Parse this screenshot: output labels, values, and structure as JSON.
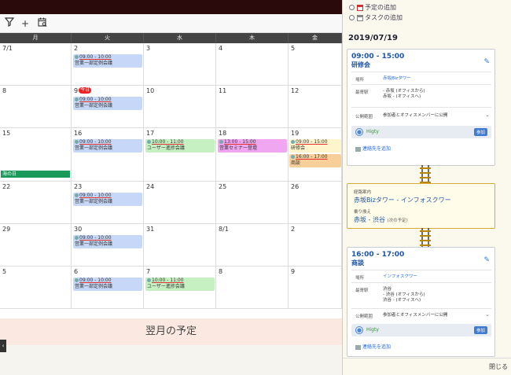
{
  "toolbar": {
    "filter_icon": "filter-icon",
    "add_icon": "plus-icon",
    "calendar_search_icon": "calendar-search-icon",
    "add_glyph": "+"
  },
  "weekdays": [
    "月",
    "火",
    "水",
    "木",
    "金"
  ],
  "weeks": [
    [
      "7/1",
      "2",
      "3",
      "4",
      "5"
    ],
    [
      "8",
      "9",
      "10",
      "11",
      "12"
    ],
    [
      "15",
      "16",
      "17",
      "18",
      "19"
    ],
    [
      "22",
      "23",
      "24",
      "25",
      "26"
    ],
    [
      "29",
      "30",
      "31",
      "8/1",
      "2"
    ],
    [
      "5",
      "6",
      "7",
      "8",
      "9"
    ]
  ],
  "today_badge": "今日",
  "holiday": "海の日",
  "events": {
    "w1_tue": {
      "time": "09:00 - 10:00",
      "title": "営業一部定例会議"
    },
    "w2_tue": {
      "time": "09:00 - 10:00",
      "title": "営業一部定例会議"
    },
    "w3_tue": {
      "time": "09:00 - 10:00",
      "title": "営業一部定例会議"
    },
    "w3_wed": {
      "time": "10:00 - 11:00",
      "title": "ユーザー進捗会議"
    },
    "w3_thu": {
      "time": "13:00 - 15:00",
      "title": "営業セミナー登壇"
    },
    "w3_fri_a": {
      "time": "09:00 - 15:00",
      "title": "研修会"
    },
    "w3_fri_b": {
      "time": "16:00 - 17:00",
      "title": "商談"
    },
    "w4_tue": {
      "time": "09:00 - 10:00",
      "title": "営業一部定例会議"
    },
    "w5_tue": {
      "time": "09:00 - 10:00",
      "title": "営業一部定例会議"
    },
    "w6_tue": {
      "time": "09:00 - 10:00",
      "title": "営業一部定例会議"
    },
    "w6_wed": {
      "time": "10:00 - 11:00",
      "title": "ユーザー進捗会議"
    }
  },
  "next_month_label": "翌月の予定",
  "side_panel": {
    "add_schedule": "予定の追加",
    "add_task": "タスクの追加",
    "date": "2019/07/19",
    "card1": {
      "time": "09:00 - 15:00",
      "title": "研修会",
      "place_label": "場所",
      "place": "赤坂Bizタワー",
      "station_label": "最寄駅",
      "stations": [
        "- 赤坂 (オフィスから)",
        "赤坂 - (オフィスへ)"
      ],
      "station_link_prefix": "赤坂",
      "visibility_label": "公開範囲",
      "visibility": "参加者とオフィスメンバーに公開",
      "member": "Higty",
      "join": "参加",
      "add_contact": "連絡先を追加"
    },
    "route": {
      "route_label": "経路案内",
      "route_value": "赤坂Bizタワー - インフォスクワー",
      "transfer_label": "乗り換え",
      "transfer_value": "赤坂 - 渋谷",
      "transfer_note": "(次の予定)"
    },
    "card2": {
      "time": "16:00 - 17:00",
      "title": "商談",
      "place_label": "場所",
      "place": "インフォスクワー",
      "station_label": "最寄駅",
      "station_main": "渋谷",
      "stations": [
        "- 渋谷 (オフィスから)",
        "渋谷 - (オフィスへ)"
      ],
      "visibility_label": "公開範囲",
      "visibility": "参加者とオフィスメンバーに公開",
      "member": "Higty",
      "join": "参加",
      "add_contact": "連絡先を追加"
    },
    "close": "閉じる",
    "chevron_glyph": "⌄",
    "pencil_glyph": "✎",
    "avatar_glyph": "●"
  },
  "left_tab_glyph": "‹",
  "colors": {
    "today": "#ee2222",
    "holiday": "#1a9a5a",
    "accent_blue": "#1c55a8",
    "header_dark": "#2a0a0a"
  }
}
